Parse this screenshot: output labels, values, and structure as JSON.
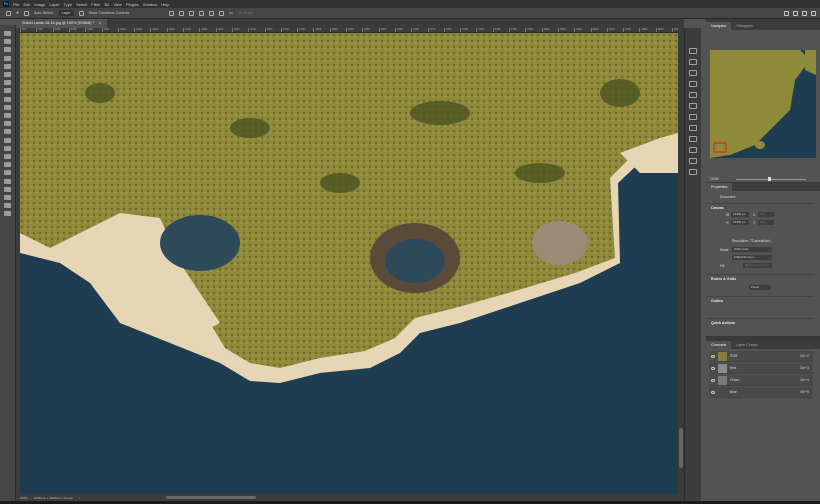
{
  "app": {
    "logo": "Ps"
  },
  "menu": [
    "File",
    "Edit",
    "Image",
    "Layer",
    "Type",
    "Select",
    "Filter",
    "3D",
    "View",
    "Plugins",
    "Window",
    "Help"
  ],
  "options": {
    "auto_select_label": "Auto-Select:",
    "auto_select_target": "Layer",
    "transform_controls_label": "Show Transform Controls",
    "mode_3d": "3D Mode:",
    "more": "•••"
  },
  "document": {
    "tab_title": "Shield Lands 18-16.jpg @ 100% (RGB/8) *",
    "close": "×"
  },
  "ruler": {
    "labels": [
      "900",
      "950",
      "1000",
      "1050",
      "1100",
      "1150",
      "1200",
      "1250",
      "1300",
      "1350",
      "1400",
      "1450",
      "1500",
      "1550",
      "1600",
      "1650",
      "1700",
      "1750",
      "1800",
      "1850",
      "1900",
      "1950",
      "2000",
      "2050",
      "2100",
      "2150",
      "2200",
      "2250",
      "2300",
      "2350",
      "2400",
      "2450",
      "2500",
      "2550",
      "2600",
      "2650",
      "2700",
      "2750",
      "2800",
      "2850",
      "2900"
    ]
  },
  "status": {
    "zoom": "100%",
    "doc_size": "16384 px x 16384 px (72 ppi)",
    "arrow": ">"
  },
  "navigator": {
    "tabs": [
      "Navigator",
      "Histogram"
    ],
    "zoom": "100%"
  },
  "properties": {
    "title": "Properties",
    "doc_label": "Document",
    "canvas": {
      "title": "Canvas",
      "w_label": "W",
      "w": "16384 px",
      "h_label": "H",
      "h": "16384 px",
      "x_label": "X",
      "x": "0 px",
      "y_label": "Y",
      "y": "0 px",
      "resolution": "Resolution: 72 pixels/inch",
      "mode_label": "Mode",
      "mode": "RGB Color",
      "depth": "8 Bits/Channel",
      "fill_label": "Fill",
      "fill": "Background Color"
    },
    "rulers_grids": {
      "title": "Rulers & Grids",
      "unit": "Pixels"
    },
    "guides": {
      "title": "Guides"
    },
    "quick_actions": {
      "title": "Quick Actions"
    }
  },
  "channels": {
    "tabs": [
      "Channels",
      "Layer Comps"
    ],
    "items": [
      {
        "name": "RGB",
        "shortcut": "Ctrl+2",
        "thumb": "#8a7d3a"
      },
      {
        "name": "Red",
        "shortcut": "Ctrl+3",
        "thumb": "#8a8a8a"
      },
      {
        "name": "Green",
        "shortcut": "Ctrl+4",
        "thumb": "#7a7a7a"
      },
      {
        "name": "Blue",
        "shortcut": "Ctrl+5",
        "thumb": "#4a4a4a"
      }
    ]
  },
  "colors": {
    "land": "#8f8a3a",
    "sand": "#e8d9bb",
    "sea": "#1e3d50",
    "forest": "#4a5420",
    "lake": "#2e4a5a"
  }
}
